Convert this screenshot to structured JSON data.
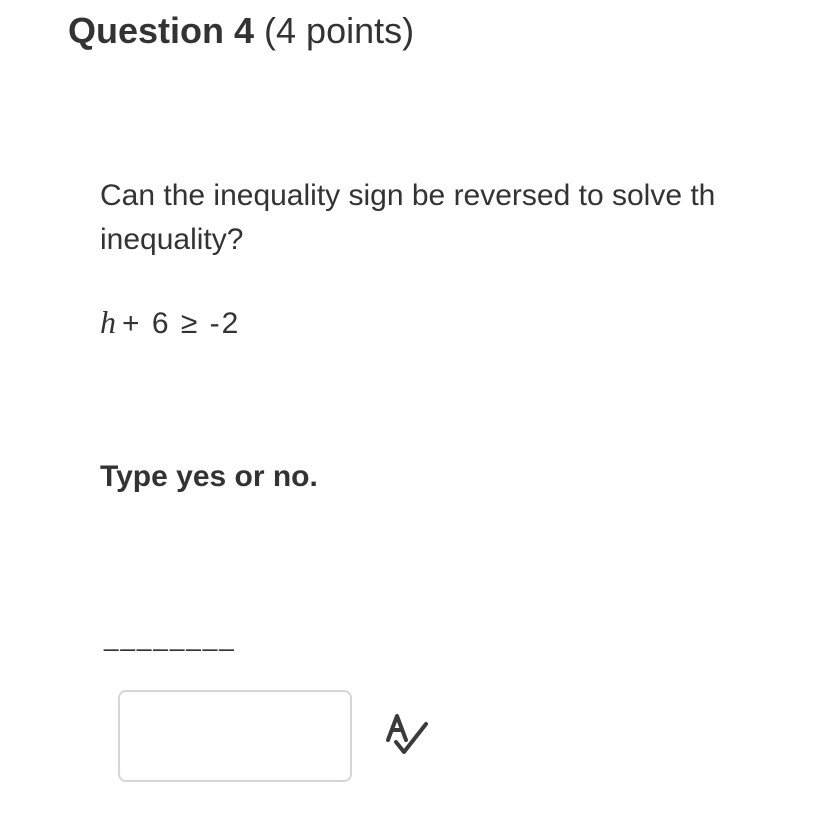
{
  "question": {
    "title": "Question 4",
    "points": "(4 points)",
    "text": "Can the inequality sign be reversed to solve th inequality?",
    "equation": {
      "variable": "h",
      "rest": "+ 6 ≥ -2"
    },
    "instruction": "Type yes or no.",
    "blank": "________"
  },
  "answer": {
    "value": "",
    "placeholder": ""
  },
  "icons": {
    "spellcheck": "spellcheck-icon"
  }
}
